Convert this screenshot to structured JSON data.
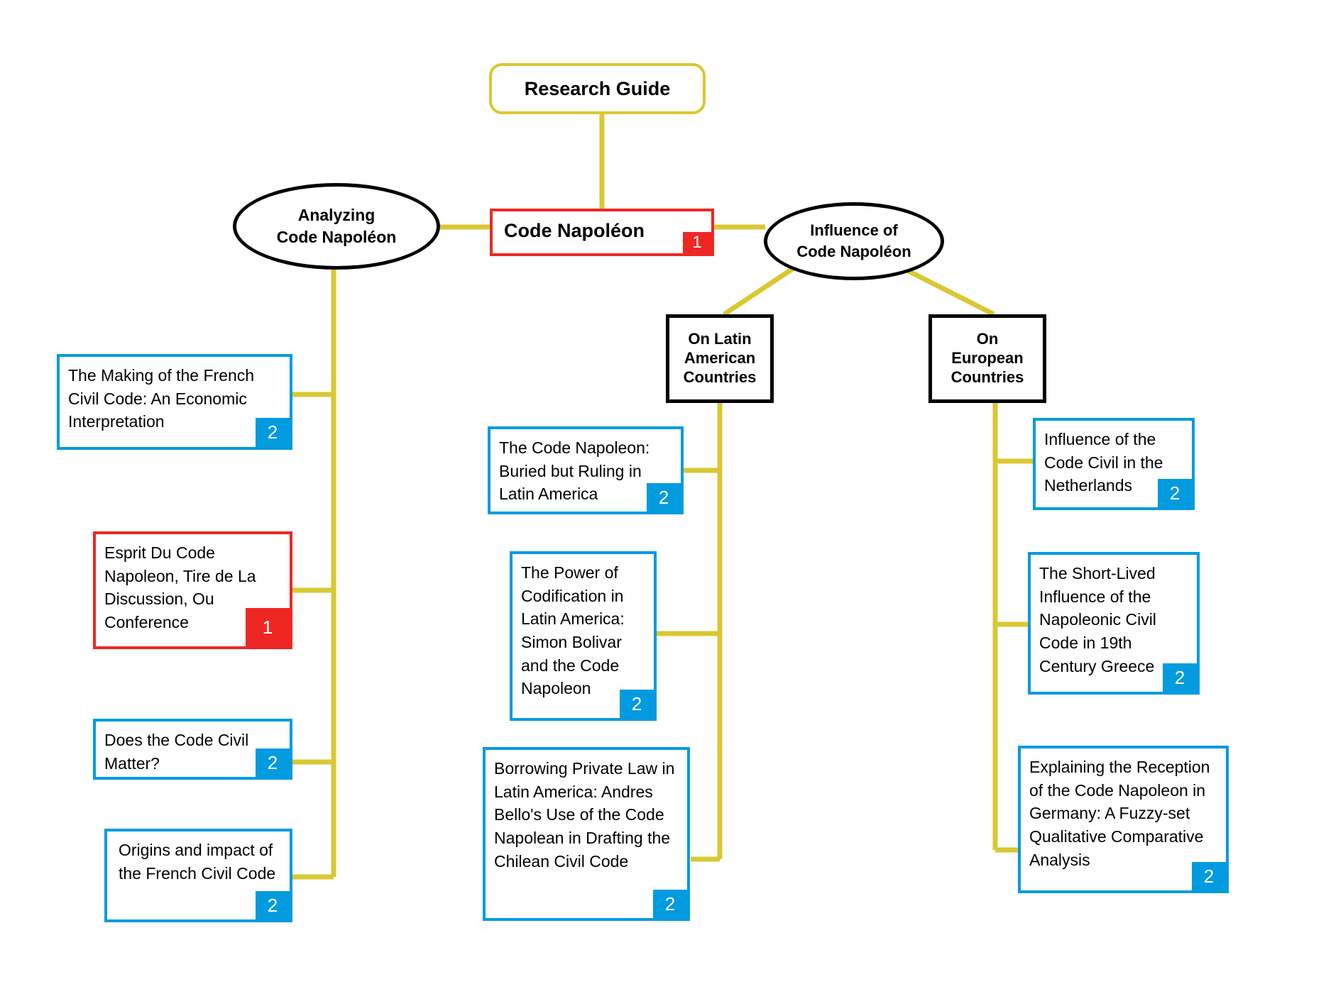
{
  "diagram": {
    "title": "Research Guide",
    "colors": {
      "connector": "#D9C832",
      "accent_blue": "#029BE0",
      "accent_red": "#EE2724",
      "node_border_black": "#000000",
      "root_border": "#D9C832",
      "background": "#FFFFFF"
    }
  },
  "root": {
    "label": "Research Guide"
  },
  "center": {
    "label": "Code Napoléon",
    "badge": "1"
  },
  "branches": {
    "left": {
      "label_line1": "Analyzing",
      "label_line2": "Code Napoléon"
    },
    "right": {
      "label_line1": "Influence of",
      "label_line2": "Code Napoléon"
    }
  },
  "subbranches": {
    "latin": {
      "line1": "On Latin",
      "line2": "American",
      "line3": "Countries"
    },
    "european": {
      "line1": "On",
      "line2": "European",
      "line3": "Countries"
    }
  },
  "cards": {
    "left": [
      {
        "title": "The Making of the French Civil Code: An Economic Interpretation",
        "badge": "2",
        "color": "blue"
      },
      {
        "title": "Esprit Du Code Napoleon, Tire de La Discussion, Ou Conference",
        "badge": "1",
        "color": "red"
      },
      {
        "title": "Does the Code Civil Matter?",
        "badge": "2",
        "color": "blue"
      },
      {
        "title": "Origins and impact of the French Civil Code",
        "badge": "2",
        "color": "blue"
      }
    ],
    "latin_american": [
      {
        "title": "The Code Napoleon: Buried but Ruling in Latin America",
        "badge": "2",
        "color": "blue"
      },
      {
        "title": "The Power of Codification in Latin America: Simon Bolivar and the Code Napoleon",
        "badge": "2",
        "color": "blue"
      },
      {
        "title": "Borrowing Private Law in Latin America: Andres Bello's Use of the Code Napolean in Drafting the Chilean Civil Code",
        "badge": "2",
        "color": "blue"
      }
    ],
    "european": [
      {
        "title": "Influence of the Code Civil in the Netherlands",
        "badge": "2",
        "color": "blue"
      },
      {
        "title": "The Short-Lived Influence of the Napoleonic Civil Code in 19th Century Greece",
        "badge": "2",
        "color": "blue"
      },
      {
        "title": "Explaining the Reception of the Code Napoleon in Germany: A Fuzzy-set Qualitative Comparative Analysis",
        "badge": "2",
        "color": "blue"
      }
    ]
  }
}
